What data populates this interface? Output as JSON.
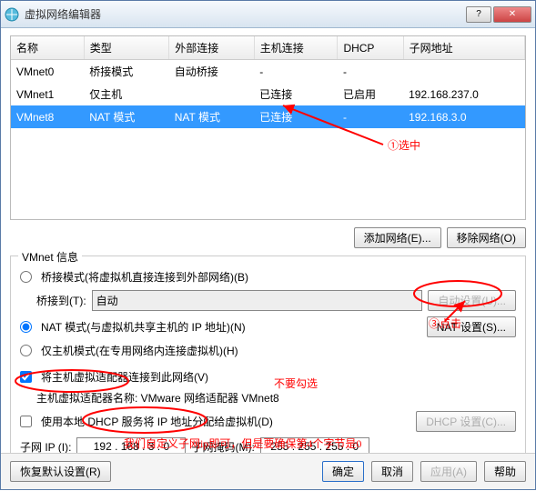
{
  "window": {
    "title": "虚拟网络编辑器"
  },
  "table": {
    "headers": [
      "名称",
      "类型",
      "外部连接",
      "主机连接",
      "DHCP",
      "子网地址"
    ],
    "rows": [
      {
        "name": "VMnet0",
        "type": "桥接模式",
        "ext": "自动桥接",
        "host": "-",
        "dhcp": "-",
        "subnet": ""
      },
      {
        "name": "VMnet1",
        "type": "仅主机",
        "ext": "",
        "host": "已连接",
        "dhcp": "已启用",
        "subnet": "192.168.237.0"
      },
      {
        "name": "VMnet8",
        "type": "NAT 模式",
        "ext": "NAT 模式",
        "host": "已连接",
        "dhcp": "-",
        "subnet": "192.168.3.0"
      }
    ]
  },
  "buttons": {
    "addNet": "添加网络(E)...",
    "removeNet": "移除网络(O)",
    "autoSet": "自动设置(U)...",
    "natSet": "NAT 设置(S)...",
    "dhcpSet": "DHCP 设置(C)...",
    "restore": "恢复默认设置(R)",
    "ok": "确定",
    "cancel": "取消",
    "apply": "应用(A)",
    "help": "帮助"
  },
  "group": {
    "legend": "VMnet 信息",
    "bridgeRadio": "桥接模式(将虚拟机直接连接到外部网络)(B)",
    "bridgeToLabel": "桥接到(T):",
    "bridgeToValue": "自动",
    "natRadio": "NAT 模式(与虚拟机共享主机的 IP 地址)(N)",
    "hostOnlyRadio": "仅主机模式(在专用网络内连接虚拟机)(H)",
    "hostAdapterCheck": "将主机虚拟适配器连接到此网络(V)",
    "hostAdapterName": "主机虚拟适配器名称: VMware 网络适配器 VMnet8",
    "dhcpCheck": "使用本地 DHCP 服务将 IP 地址分配给虚拟机(D)",
    "subnetIpLabel": "子网 IP (I):",
    "subnetIpValue": "192 . 168 .   3  .   0",
    "subnetMaskLabel": "子网掩码(M):",
    "subnetMaskValue": "255 . 255 . 255 .  0"
  },
  "annotations": {
    "selectNote": "①选中",
    "clickNote": "③点击",
    "noCheckNote": "不要勾选",
    "bottomNote": "我们自定义子网ip即可，但是要确保第4个字节是0"
  }
}
